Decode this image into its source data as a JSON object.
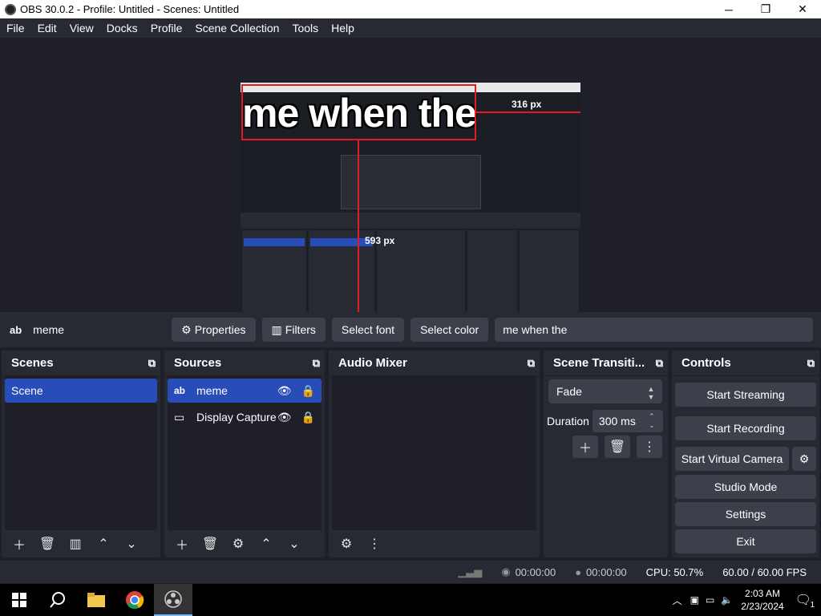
{
  "window": {
    "title": "OBS 30.0.2 - Profile: Untitled - Scenes: Untitled",
    "minimize": "─",
    "maximize": "❐",
    "close": "✕"
  },
  "menu": [
    "File",
    "Edit",
    "View",
    "Docks",
    "Profile",
    "Scene Collection",
    "Tools",
    "Help"
  ],
  "preview": {
    "meme_text": "me when the",
    "width_label": "316 px",
    "height_label": "593 px"
  },
  "context_bar": {
    "source_name": "meme",
    "properties": "Properties",
    "filters": "Filters",
    "select_font": "Select font",
    "select_color": "Select color",
    "text_value": "me when the"
  },
  "scenes": {
    "title": "Scenes",
    "items": [
      "Scene"
    ]
  },
  "sources": {
    "title": "Sources",
    "items": [
      {
        "name": "meme",
        "type": "text"
      },
      {
        "name": "Display Capture",
        "type": "display"
      }
    ]
  },
  "audio_mixer": {
    "title": "Audio Mixer"
  },
  "transitions": {
    "title": "Scene Transiti...",
    "selected": "Fade",
    "duration_label": "Duration",
    "duration_value": "300 ms"
  },
  "controls": {
    "title": "Controls",
    "buttons": [
      "Start Streaming",
      "Start Recording",
      "Start Virtual Camera",
      "Studio Mode",
      "Settings",
      "Exit"
    ]
  },
  "status": {
    "stream_time": "00:00:00",
    "rec_time": "00:00:00",
    "cpu": "CPU: 50.7%",
    "fps": "60.00 / 60.00 FPS"
  },
  "taskbar": {
    "time": "2:03 AM",
    "date": "2/23/2024",
    "notifications": "1"
  }
}
